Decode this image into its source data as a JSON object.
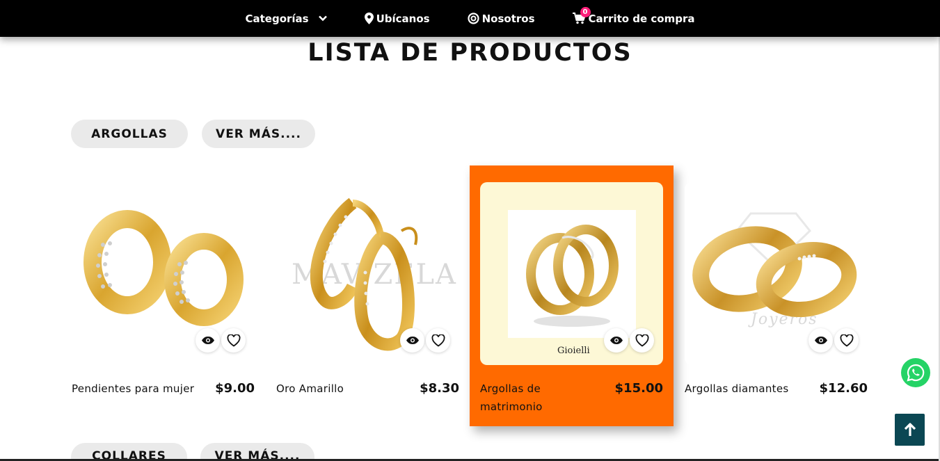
{
  "nav": {
    "items": [
      {
        "label": "Categorías",
        "icon": "chevron-down-icon"
      },
      {
        "label": "Ubícanos",
        "icon": "map-marker-icon"
      },
      {
        "label": "Nosotros",
        "icon": "target-icon"
      },
      {
        "label": "Carrito de compra",
        "icon": "cart-icon"
      }
    ],
    "cart_count": "0"
  },
  "page_title": "LISTA DE PRODUCTOS",
  "sections": [
    {
      "category_label": "ARGOLLAS",
      "more_label": "VER MÁS....",
      "products": [
        {
          "name": "Pendientes para mujer",
          "price": "$9.00"
        },
        {
          "name": "Oro Amarillo",
          "price": "$8.30",
          "watermark": "MAV ZELA"
        },
        {
          "name": "Argollas de matrimonio",
          "price": "$15.00",
          "brand": "Gioielli"
        },
        {
          "name": "Argollas diamantes",
          "price": "$12.60",
          "watermark": "Joyeros"
        }
      ]
    },
    {
      "category_label": "COLLARES",
      "more_label": "VER MÁS...."
    }
  ],
  "colors": {
    "nav_bg": "#000000",
    "featured_bg": "#ff6a00",
    "featured_img_bg": "#fdf8d6",
    "pill_bg": "#eaeaea",
    "badge": "#ff1f7a",
    "whatsapp": "#25d366",
    "back_to_top": "#0b4753"
  }
}
